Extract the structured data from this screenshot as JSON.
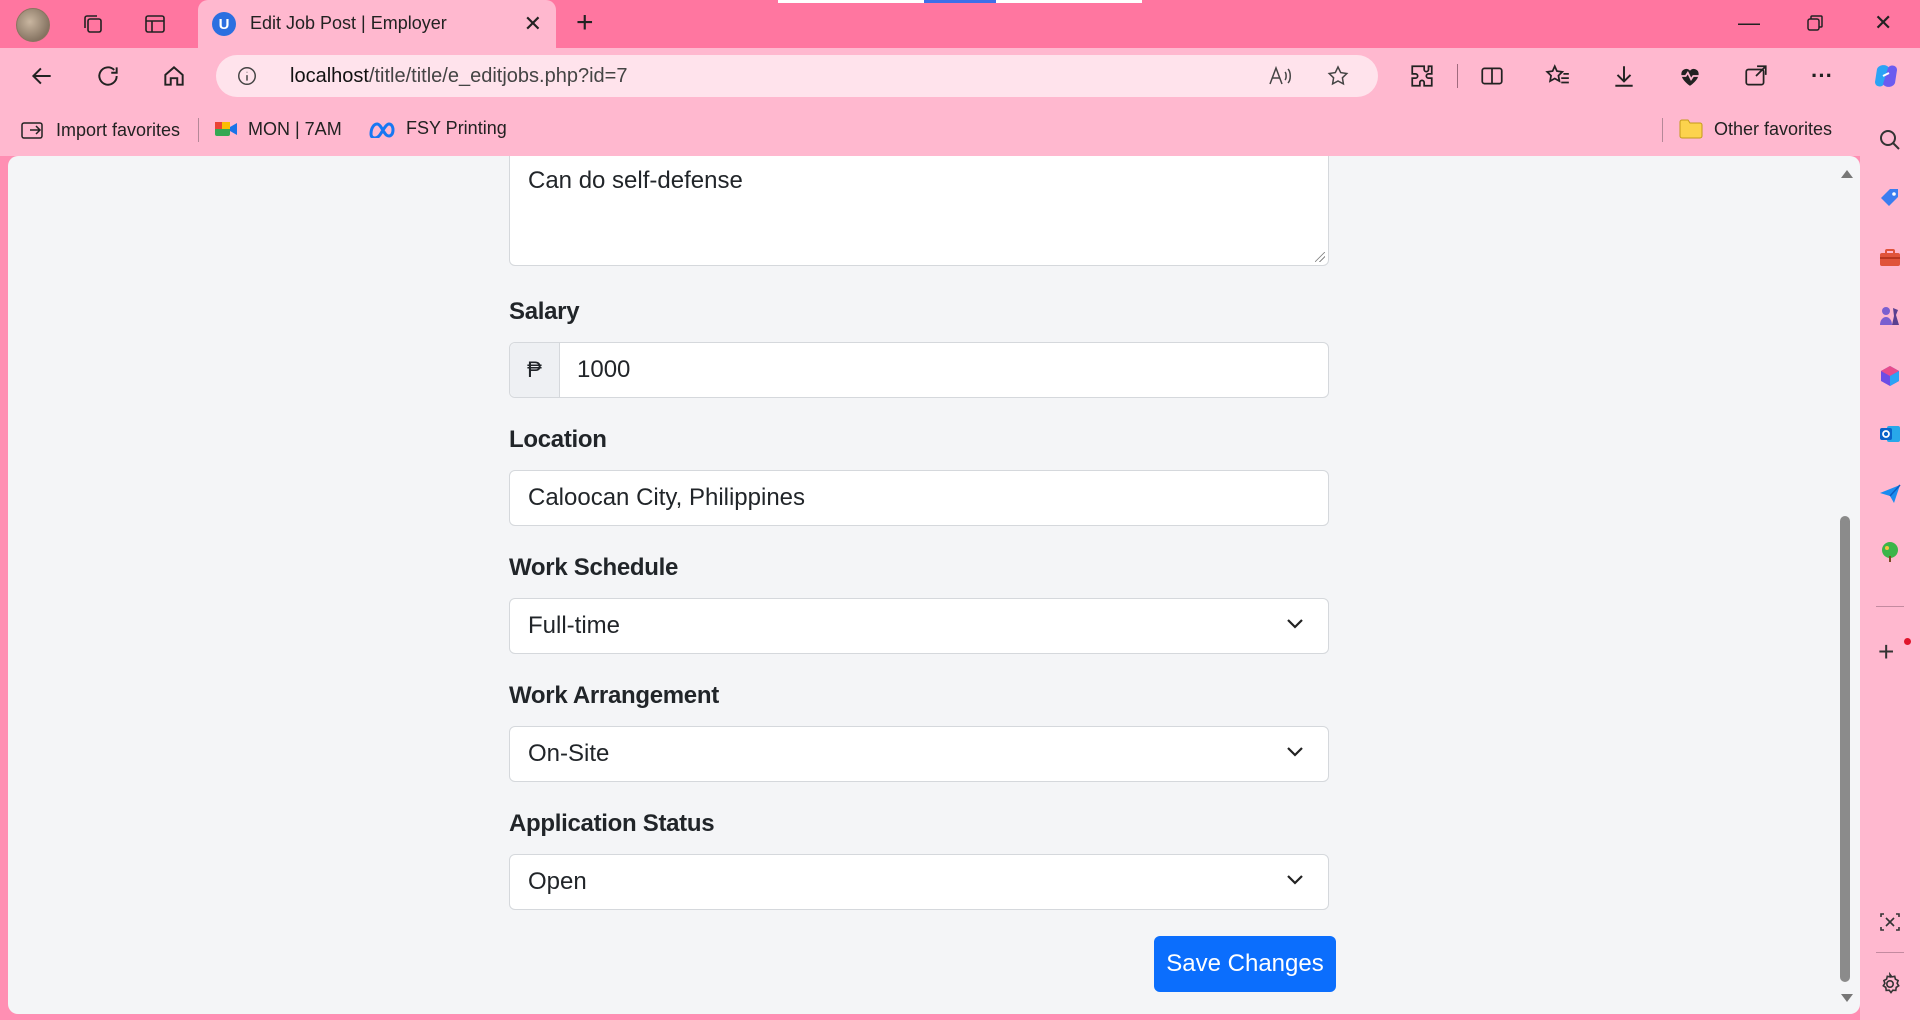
{
  "browser": {
    "tab_title": "Edit Job Post | Employer",
    "url_host": "localhost",
    "url_path": "/title/title/e_editjobs.php?id=7"
  },
  "favorites": {
    "import": "Import favorites",
    "item1": "MON | 7AM",
    "item2": "FSY Printing",
    "other": "Other favorites"
  },
  "form": {
    "description_value": "Can do self-defense",
    "salary_label": "Salary",
    "currency_symbol": "₱",
    "salary_value": "1000",
    "location_label": "Location",
    "location_value": "Caloocan City, Philippines",
    "schedule_label": "Work Schedule",
    "schedule_value": "Full-time",
    "arrangement_label": "Work Arrangement",
    "arrangement_value": "On-Site",
    "status_label": "Application Status",
    "status_value": "Open",
    "save_label": "Save Changes"
  },
  "colors": {
    "primary_button": "#0b6efd",
    "browser_frame": "#ffb8cf",
    "tab_strip": "#ff76a0"
  }
}
